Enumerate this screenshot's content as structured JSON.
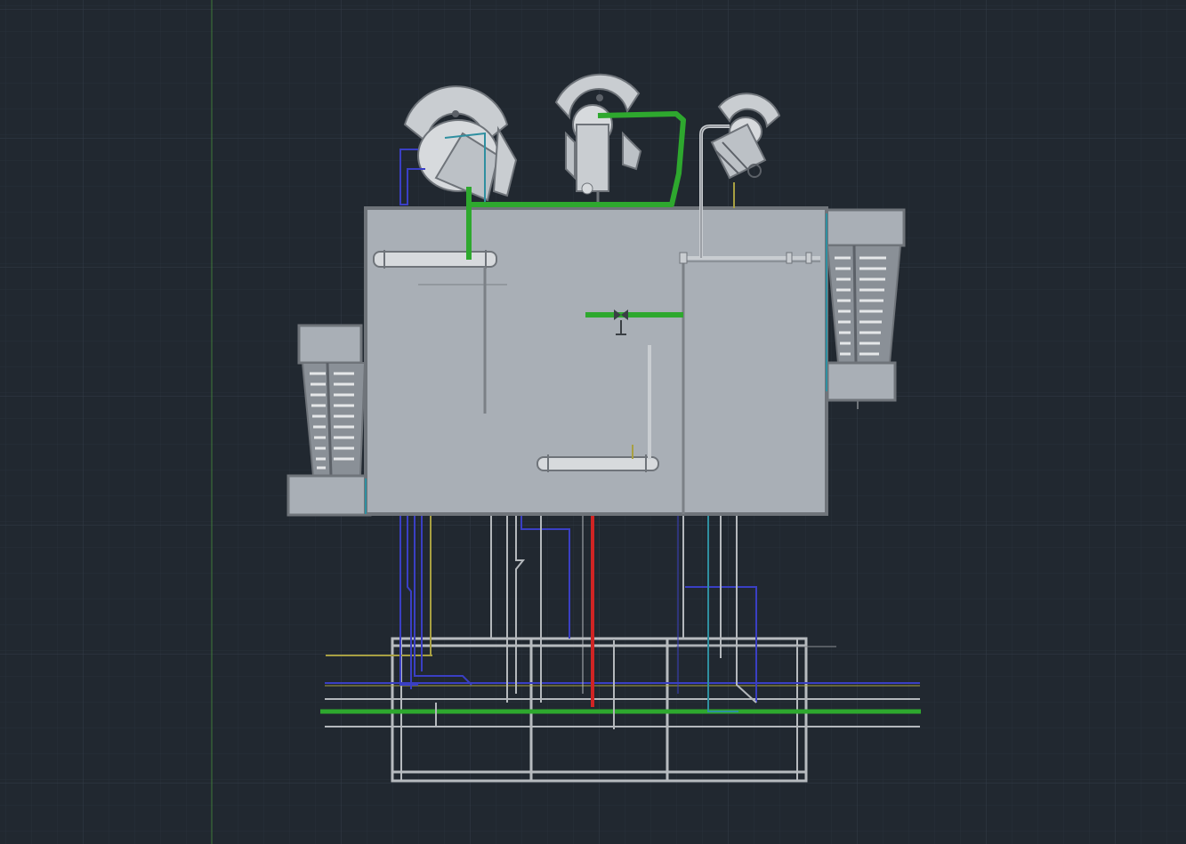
{
  "viewport": {
    "background": "#212830",
    "grid_minor_color": "#28303a",
    "grid_major_color": "#333c47",
    "axis_color": "#3f7a3a"
  },
  "colors": {
    "vessel_body": "#a9afb6",
    "steel": "#c9cdd1",
    "steel_dark": "#5c6168",
    "outline": "#6f747a",
    "green_pipe": "#2ea82e",
    "red_pipe": "#d02424",
    "blue_pipe": "#3a3fc4",
    "cyan_pipe": "#2f8fa0",
    "yellow_pipe": "#a8a042",
    "gray_pipe": "#b4b8bc"
  },
  "model": {
    "main_enclosure": "main-enclosure",
    "top_equipment": [
      "horizontal-vessel-left",
      "vertical-vessel-center",
      "small-vessel-right"
    ],
    "side_stairs": [
      "left-stair-tower",
      "right-stair-tower"
    ],
    "support_frame": "pipe-rack-frame"
  }
}
